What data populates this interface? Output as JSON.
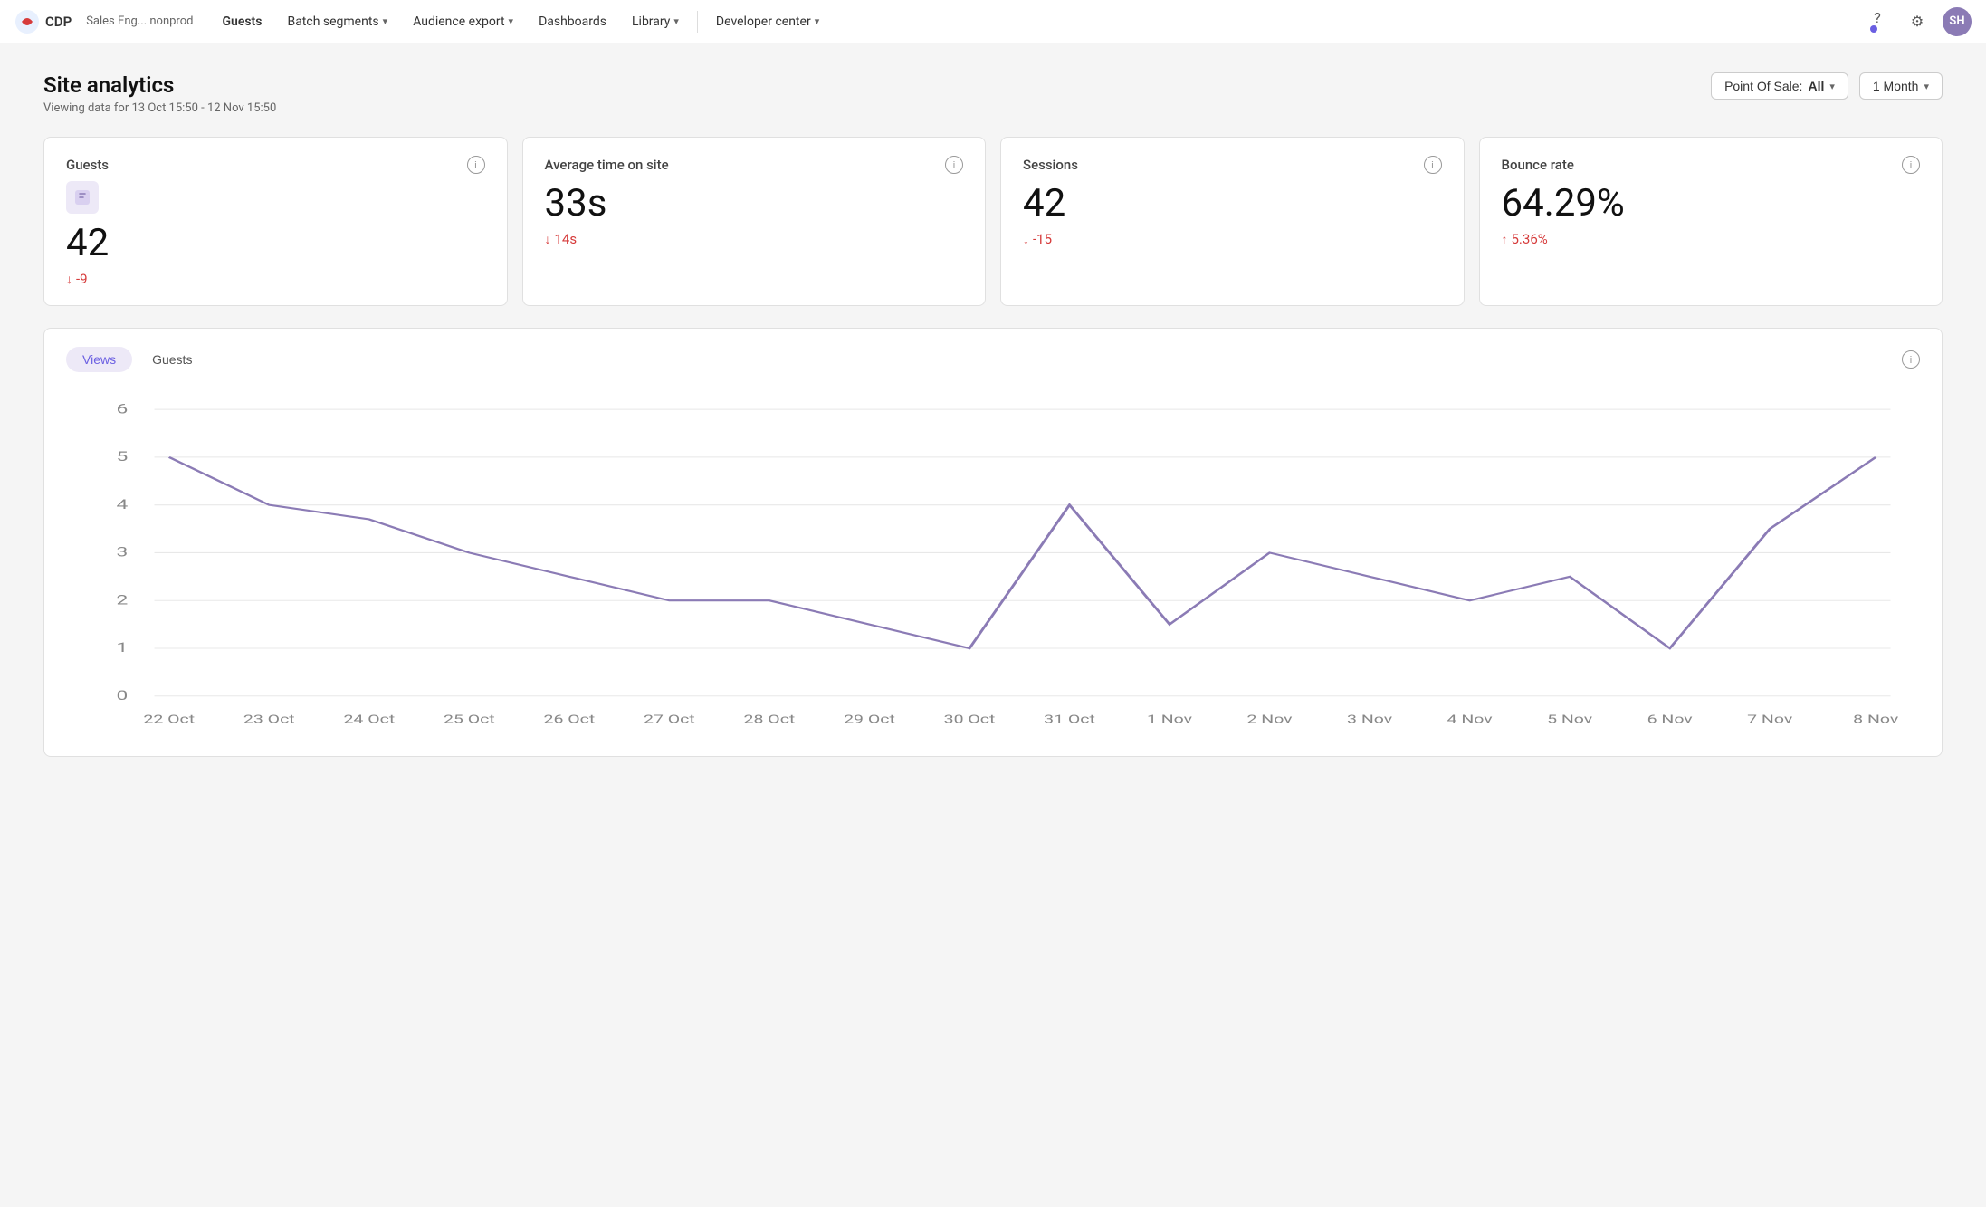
{
  "app": {
    "brand": "CDP",
    "context": "Sales Eng... nonprod"
  },
  "nav": {
    "items": [
      {
        "label": "Guests",
        "active": true,
        "hasDropdown": false
      },
      {
        "label": "Batch segments",
        "active": false,
        "hasDropdown": true
      },
      {
        "label": "Audience export",
        "active": false,
        "hasDropdown": true
      },
      {
        "label": "Dashboards",
        "active": false,
        "hasDropdown": false
      },
      {
        "label": "Library",
        "active": false,
        "hasDropdown": true
      },
      {
        "label": "Developer center",
        "active": false,
        "hasDropdown": true
      }
    ],
    "avatar_initials": "SH"
  },
  "page": {
    "title": "Site analytics",
    "subtitle": "Viewing data for 13 Oct 15:50 - 12 Nov 15:50"
  },
  "controls": {
    "pos_label": "Point Of Sale:",
    "pos_value": "All",
    "time_label": "1 Month"
  },
  "metrics": [
    {
      "id": "guests",
      "title": "Guests",
      "value": "42",
      "delta": "-9",
      "delta_direction": "down",
      "delta_positive": false
    },
    {
      "id": "avg_time",
      "title": "Average time on site",
      "value": "33s",
      "delta": "14s",
      "delta_direction": "down",
      "delta_positive": false
    },
    {
      "id": "sessions",
      "title": "Sessions",
      "value": "42",
      "delta": "-15",
      "delta_direction": "down",
      "delta_positive": false
    },
    {
      "id": "bounce_rate",
      "title": "Bounce rate",
      "value": "64.29%",
      "delta": "5.36%",
      "delta_direction": "up",
      "delta_positive": true
    }
  ],
  "chart": {
    "tabs": [
      "Views",
      "Guests"
    ],
    "active_tab": "Views",
    "info_icon": "ⓘ",
    "y_labels": [
      "6",
      "5",
      "4",
      "3",
      "2",
      "1",
      "0"
    ],
    "x_labels": [
      "22 Oct",
      "23 Oct",
      "24 Oct",
      "25 Oct",
      "26 Oct",
      "27 Oct",
      "28 Oct",
      "29 Oct",
      "30 Oct",
      "31 Oct",
      "1 Nov",
      "2 Nov",
      "3 Nov",
      "4 Nov",
      "5 Nov",
      "6 Nov",
      "7 Nov",
      "8 Nov"
    ],
    "data_points": [
      5,
      4,
      3.7,
      3,
      2.5,
      2,
      2,
      1.5,
      1,
      4,
      1.5,
      3,
      2.5,
      2,
      2.5,
      1,
      3.5,
      5
    ]
  }
}
